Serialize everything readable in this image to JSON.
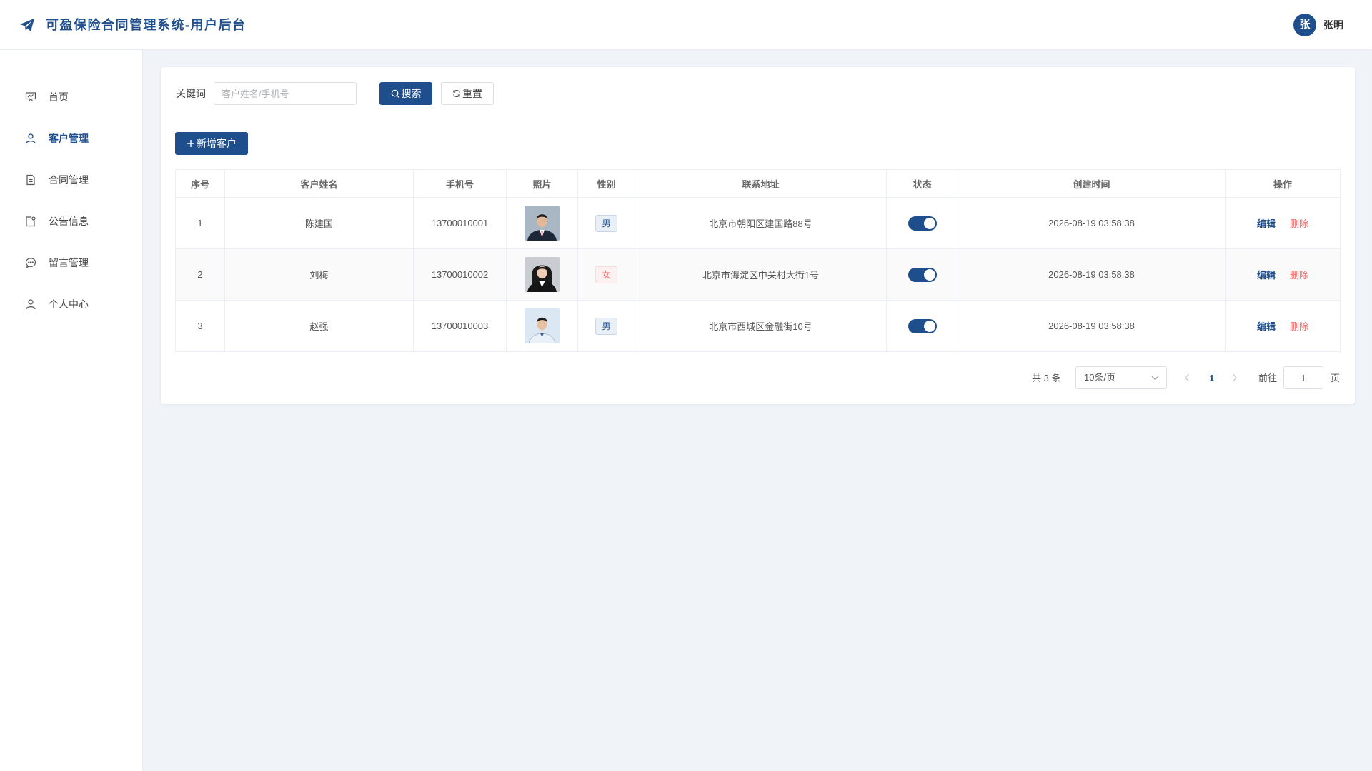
{
  "app": {
    "title": "可盈保险合同管理系统-用户后台"
  },
  "user": {
    "avatar_text": "张",
    "name": "张明"
  },
  "sidebar": {
    "items": [
      {
        "label": "首页",
        "icon": "presentation-icon",
        "active": false
      },
      {
        "label": "客户管理",
        "icon": "user-icon",
        "active": true
      },
      {
        "label": "合同管理",
        "icon": "document-icon",
        "active": false
      },
      {
        "label": "公告信息",
        "icon": "notice-icon",
        "active": false
      },
      {
        "label": "留言管理",
        "icon": "chat-icon",
        "active": false
      },
      {
        "label": "个人中心",
        "icon": "user-icon",
        "active": false
      }
    ]
  },
  "search": {
    "label": "关键词",
    "placeholder": "客户姓名/手机号",
    "value": "",
    "search_button": "搜索",
    "reset_button": "重置"
  },
  "toolbar": {
    "add_button": "新增客户"
  },
  "table": {
    "headers": [
      "序号",
      "客户姓名",
      "手机号",
      "照片",
      "性别",
      "联系地址",
      "状态",
      "创建时间",
      "操作"
    ],
    "rows": [
      {
        "index": "1",
        "name": "陈建国",
        "phone": "13700010001",
        "gender": "男",
        "address": "北京市朝阳区建国路88号",
        "status": true,
        "created": "2026-08-19 03:58:38",
        "edit": "编辑",
        "delete": "删除"
      },
      {
        "index": "2",
        "name": "刘梅",
        "phone": "13700010002",
        "gender": "女",
        "address": "北京市海淀区中关村大街1号",
        "status": true,
        "created": "2026-08-19 03:58:38",
        "edit": "编辑",
        "delete": "删除"
      },
      {
        "index": "3",
        "name": "赵强",
        "phone": "13700010003",
        "gender": "男",
        "address": "北京市西城区金融街10号",
        "status": true,
        "created": "2026-08-19 03:58:38",
        "edit": "编辑",
        "delete": "删除"
      }
    ]
  },
  "pagination": {
    "total_text": "共 3 条",
    "page_size": "10条/页",
    "current_page": "1",
    "goto_label": "前往",
    "goto_value": "1",
    "page_unit": "页"
  },
  "colors": {
    "primary": "#1f4e8c",
    "danger": "#f56c6c",
    "background": "#f0f3f8"
  }
}
